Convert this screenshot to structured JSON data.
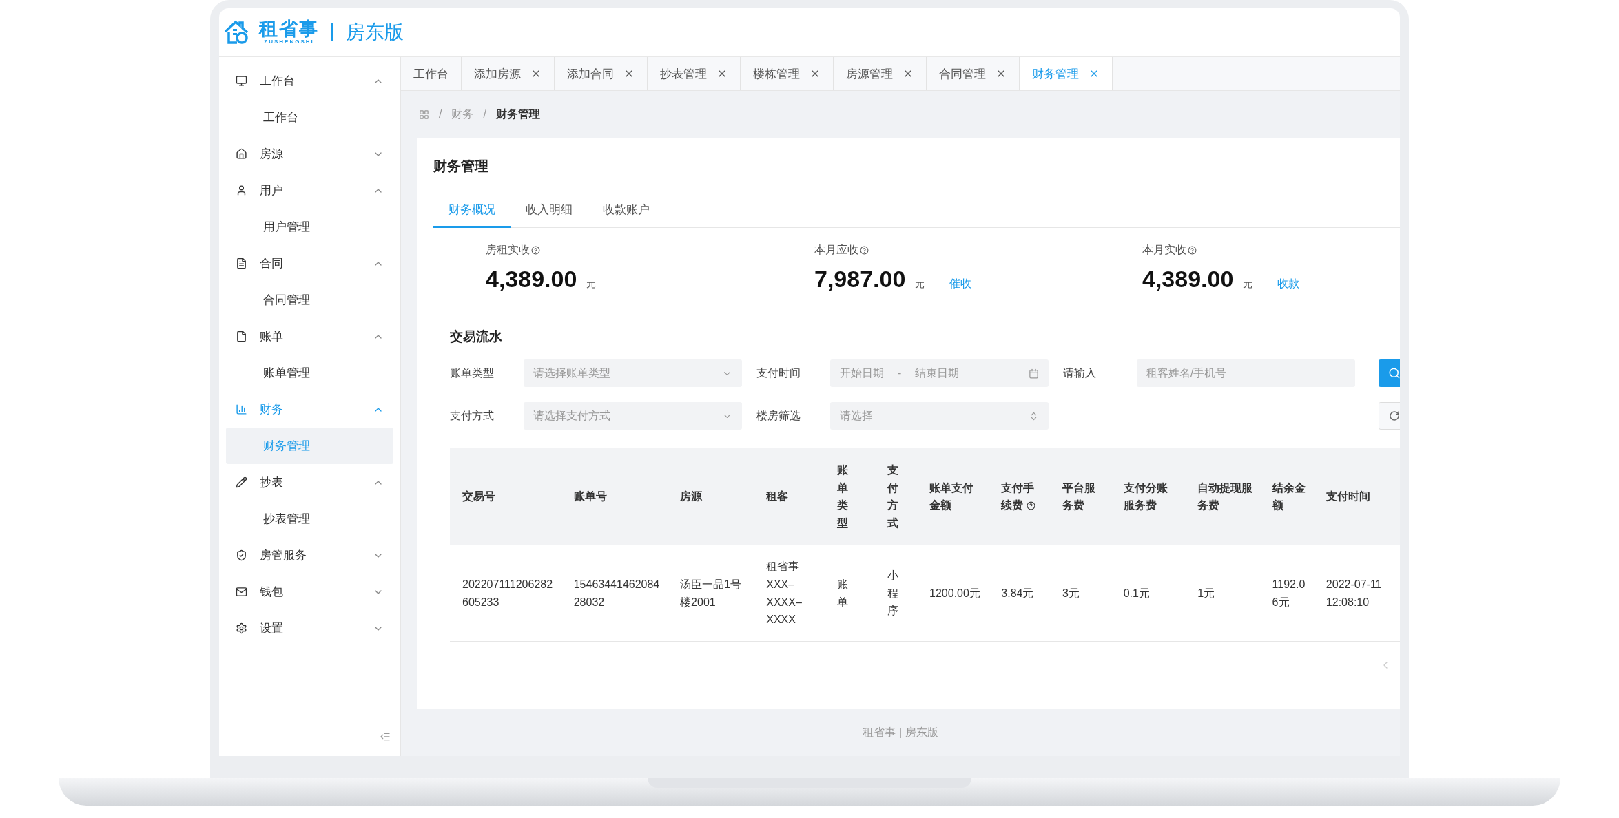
{
  "logo": {
    "name": "租省事",
    "pinyin": "ZUSHENGSHI",
    "edition": "房东版"
  },
  "sidebar": {
    "items": [
      {
        "label": "工作台",
        "expanded": true,
        "children": [
          {
            "label": "工作台",
            "selected": false
          }
        ]
      },
      {
        "label": "房源",
        "expanded": false
      },
      {
        "label": "用户",
        "expanded": true,
        "children": [
          {
            "label": "用户管理",
            "selected": false
          }
        ]
      },
      {
        "label": "合同",
        "expanded": true,
        "children": [
          {
            "label": "合同管理",
            "selected": false
          }
        ]
      },
      {
        "label": "账单",
        "expanded": true,
        "children": [
          {
            "label": "账单管理",
            "selected": false
          }
        ]
      },
      {
        "label": "财务",
        "expanded": true,
        "children": [
          {
            "label": "财务管理",
            "selected": true
          }
        ]
      },
      {
        "label": "抄表",
        "expanded": true,
        "children": [
          {
            "label": "抄表管理",
            "selected": false
          }
        ]
      },
      {
        "label": "房管服务",
        "expanded": false
      },
      {
        "label": "钱包",
        "expanded": false
      },
      {
        "label": "设置",
        "expanded": false
      }
    ]
  },
  "tabs": [
    {
      "label": "工作台",
      "closable": false,
      "selected": false
    },
    {
      "label": "添加房源",
      "closable": true,
      "selected": false
    },
    {
      "label": "添加合同",
      "closable": true,
      "selected": false
    },
    {
      "label": "抄表管理",
      "closable": true,
      "selected": false
    },
    {
      "label": "楼栋管理",
      "closable": true,
      "selected": false
    },
    {
      "label": "房源管理",
      "closable": true,
      "selected": false
    },
    {
      "label": "合同管理",
      "closable": true,
      "selected": false
    },
    {
      "label": "财务管理",
      "closable": true,
      "selected": true
    }
  ],
  "breadcrumb": {
    "separator": "/",
    "items": [
      "财务",
      "财务管理"
    ]
  },
  "card": {
    "title": "财务管理",
    "subtabs": [
      {
        "label": "财务概况",
        "selected": true
      },
      {
        "label": "收入明细",
        "selected": false
      },
      {
        "label": "收款账户",
        "selected": false
      }
    ],
    "stats": [
      {
        "label": "房租实收",
        "value": "4,389.00",
        "unit": "元"
      },
      {
        "label": "本月应收",
        "value": "7,987.00",
        "unit": "元",
        "action": "催收"
      },
      {
        "label": "本月实收",
        "value": "4,389.00",
        "unit": "元",
        "action": "收款"
      }
    ],
    "section_title": "交易流水",
    "filters": [
      [
        {
          "label": "账单类型",
          "kind": "select",
          "placeholder": "请选择账单类型"
        },
        {
          "label": "支付时间",
          "kind": "daterange",
          "start_placeholder": "开始日期",
          "separator": "-",
          "end_placeholder": "结束日期"
        },
        {
          "label": "请输入",
          "kind": "input",
          "placeholder": "租客姓名/手机号"
        }
      ],
      [
        {
          "label": "支付方式",
          "kind": "select",
          "placeholder": "请选择支付方式"
        },
        {
          "label": "楼房筛选",
          "kind": "cascader",
          "placeholder": "请选择"
        }
      ]
    ],
    "table": {
      "columns": [
        {
          "label": "交易号",
          "help": false
        },
        {
          "label": "账单号",
          "help": false
        },
        {
          "label": "房源",
          "help": false
        },
        {
          "label": "租客",
          "help": false
        },
        {
          "label": "账单类型",
          "help": false
        },
        {
          "label": "支付方式",
          "help": false
        },
        {
          "label": "账单支付金额",
          "help": false
        },
        {
          "label": "支付手续费",
          "help": true
        },
        {
          "label": "平台服务费",
          "help": false
        },
        {
          "label": "支付分账服务费",
          "help": false
        },
        {
          "label": "自动提现服务费",
          "help": false
        },
        {
          "label": "结余金额",
          "help": false
        },
        {
          "label": "支付时间",
          "help": false
        }
      ],
      "rows": [
        [
          "202207111206282605233",
          "1546344146208428032",
          "汤臣一品1号楼2001",
          "租省事XXX–XXXX–XXXX",
          "账单",
          "小程序",
          "1200.00元",
          "3.84元",
          "3元",
          "0.1元",
          "1元",
          "1192.06元",
          "2022-07-11 12:08:10"
        ]
      ]
    }
  },
  "footer": "租省事 | 房东版"
}
